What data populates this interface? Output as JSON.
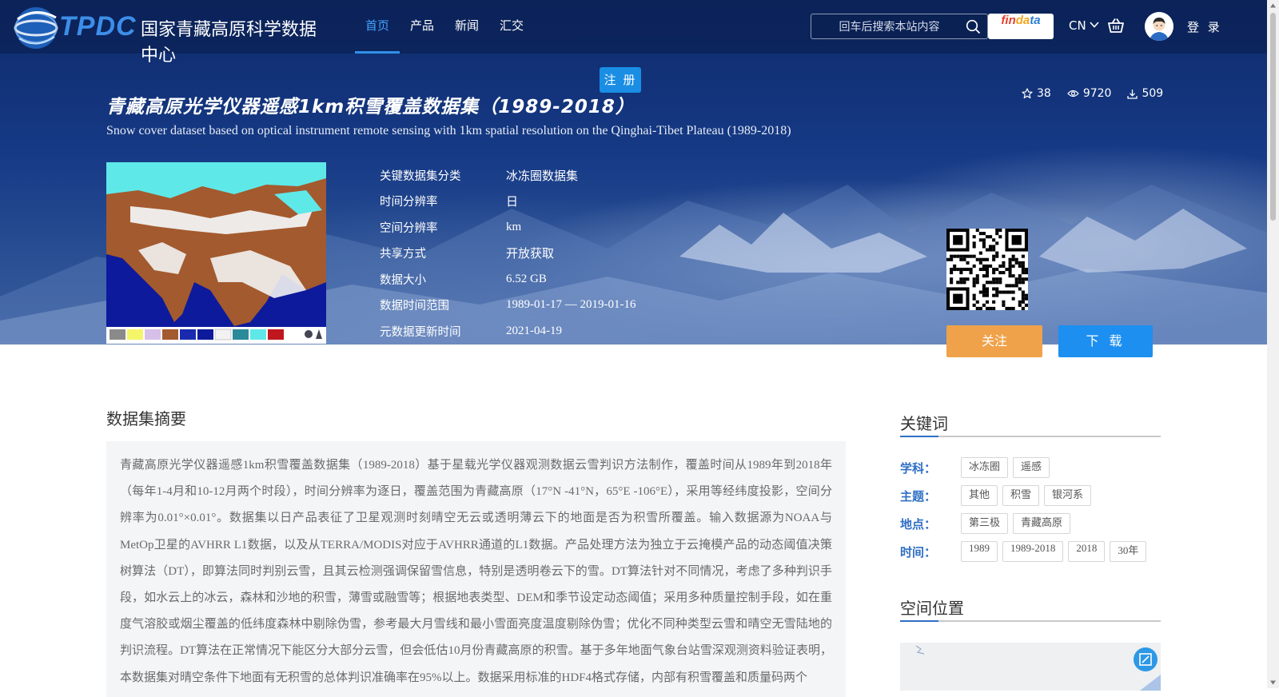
{
  "header": {
    "logo_mark": "TPDC",
    "logo_name": "国家青藏高原科学数据中心",
    "nav": [
      {
        "label": "首页",
        "active": true
      },
      {
        "label": "产品",
        "active": false
      },
      {
        "label": "新闻",
        "active": false
      },
      {
        "label": "汇交",
        "active": false
      }
    ],
    "search_placeholder": "回车后搜索本站内容",
    "findata_parts": [
      "fin",
      "da",
      "ta"
    ],
    "lang": "CN",
    "login_label": "登 录"
  },
  "hero": {
    "register_label": "注 册",
    "title_cn": "青藏高原光学仪器遥感1km积雪覆盖数据集（1989-2018）",
    "title_en": "Snow cover dataset based on optical instrument remote sensing with 1km spatial resolution on the Qinghai-Tibet Plateau (1989-2018)",
    "stats": {
      "stars": "38",
      "views": "9720",
      "downloads": "509"
    },
    "meta": [
      {
        "key": "关键数据集分类",
        "value": "冰冻圈数据集"
      },
      {
        "key": "时间分辨率",
        "value": "日"
      },
      {
        "key": "空间分辨率",
        "value": "km"
      },
      {
        "key": "共享方式",
        "value": "开放获取"
      },
      {
        "key": "数据大小",
        "value": "6.52 GB"
      },
      {
        "key": "数据时间范围",
        "value": "1989-01-17 — 2019-01-16"
      },
      {
        "key": "元数据更新时间",
        "value": "2021-04-19"
      }
    ],
    "follow_label": "关注",
    "download_label": "下 载"
  },
  "abstract": {
    "title": "数据集摘要",
    "text": "青藏高原光学仪器遥感1km积雪覆盖数据集（1989-2018）基于星载光学仪器观测数据云雪判识方法制作，覆盖时间从1989年到2018年（每年1-4月和10-12月两个时段），时间分辨率为逐日，覆盖范围为青藏高原（17°N -41°N，65°E -106°E），采用等经纬度投影，空间分辨率为0.01°×0.01°。数据集以日产品表征了卫星观测时刻晴空无云或透明薄云下的地面是否为积雪所覆盖。输入数据源为NOAA与MetOp卫星的AVHRR L1数据，以及从TERRA/MODIS对应于AVHRR通道的L1数据。产品处理方法为独立于云掩模产品的动态阈值决策树算法（DT），即算法同时判别云雪，且其云检测强调保留雪信息，特别是透明卷云下的雪。DT算法针对不同情况，考虑了多种判识手段，如水云上的冰云，森林和沙地的积雪，薄雪或融雪等；根据地表类型、DEM和季节设定动态阈值；采用多种质量控制手段，如在重度气溶胶或烟尘覆盖的低纬度森林中剔除伪雪，参考最大月雪线和最小雪面亮度温度剔除伪雪；优化不同种类型云雪和晴空无雪陆地的判识流程。DT算法在正常情况下能区分大部分云雪，但会低估10月份青藏高原的积雪。基于多年地面气象台站雪深观测资料验证表明，本数据集对晴空条件下地面有无积雪的总体判识准确率在95%以上。数据采用标准的HDF4格式存储，内部有积雪覆盖和质量码两个"
  },
  "keywords": {
    "title": "关键词",
    "groups": [
      {
        "label": "学科：",
        "tags": [
          "冰冻圈",
          "遥感"
        ]
      },
      {
        "label": "主题：",
        "tags": [
          "其他",
          "积雪",
          "银河系"
        ]
      },
      {
        "label": "地点：",
        "tags": [
          "第三极",
          "青藏高原"
        ]
      },
      {
        "label": "时间：",
        "tags": [
          "1989",
          "1989-2018",
          "2018",
          "30年"
        ]
      }
    ]
  },
  "location": {
    "title": "空间位置"
  },
  "colors": {
    "accent_blue": "#1c8ff0",
    "follow_orange": "#f0a24a",
    "keyword_label": "#2f6fc4",
    "nav_active": "#46a3ff"
  },
  "icons": [
    "globe-logo-icon",
    "search-icon",
    "chevron-down-icon",
    "cart-icon",
    "user-avatar-icon",
    "star-icon",
    "eye-icon",
    "download-icon",
    "qr-code-icon",
    "map-expand-icon"
  ]
}
